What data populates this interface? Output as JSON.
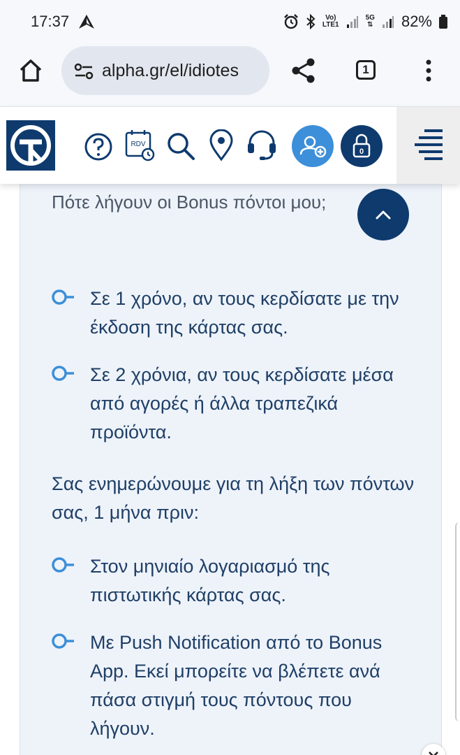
{
  "status_bar": {
    "time": "17:37",
    "network_volte": "Vo)",
    "network_lte": "LTE1",
    "network_5g": "5G",
    "battery": "82%"
  },
  "browser": {
    "url": "alpha.gr/el/idiotes",
    "tab_count": "1",
    "icons": [
      "home-icon",
      "site-info-icon",
      "share-icon",
      "tabs-icon",
      "more-vert-icon"
    ]
  },
  "site_header": {
    "rdv_label": "RDV",
    "lock_count": "0",
    "icons": [
      "alpha-bank-logo",
      "help-icon",
      "appointment-icon",
      "search-icon",
      "location-icon",
      "support-headset-icon",
      "add-user-icon",
      "lock-icon",
      "hamburger-menu-icon"
    ],
    "colors": {
      "brand": "#0e3a6e",
      "accent": "#3c8fd8"
    }
  },
  "faq": {
    "question": "Πότε λήγουν οι Bonus πόντοι μου;",
    "answers": [
      "Σε 1 χρόνο, αν τους κερδίσατε με την έκδοση της κάρτας σας.",
      "Σε 2 χρόνια, αν τους κερδίσατε μέσα από αγορές ή άλλα τραπεζικά προϊόντα."
    ],
    "info": "Σας ενημερώνουμε για τη λήξη των πόντων σας, 1 μήνα πριν:",
    "notify_methods": [
      "Στον μηνιαίο λογαριασμό της πιστωτικής κάρτας σας.",
      "Με Push Notification από το Bonus App. Εκεί μπορείτε να βλέπετε ανά πάσα στιγμή τους πόντους που λήγουν."
    ],
    "colors": {
      "text": "#1f3f66",
      "bullet": "#3c8fd8",
      "card_bg": "#eef3fa"
    }
  }
}
